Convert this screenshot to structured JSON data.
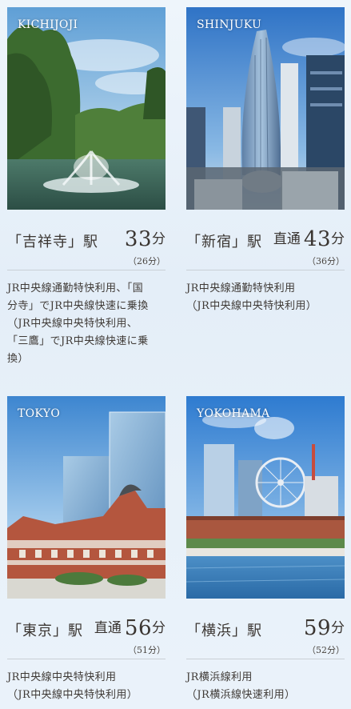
{
  "cards": [
    {
      "photo_label": "KICHIJOJI",
      "station": "「吉祥寺」駅",
      "direct": "",
      "minutes": "33",
      "unit": "分",
      "sub": "（26分）",
      "desc": [
        "JR中央線通勤特快利用、「国",
        "分寺」でJR中央線快速に乗換",
        "（JR中央線中央特快利用、",
        "「三鷹」でJR中央線快速に乗",
        "換）"
      ]
    },
    {
      "photo_label": "SHINJUKU",
      "station": "「新宿」駅",
      "direct": "直通",
      "minutes": "43",
      "unit": "分",
      "sub": "（36分）",
      "desc": [
        "JR中央線通勤特快利用",
        "（JR中央線中央特快利用）"
      ]
    },
    {
      "photo_label": "TOKYO",
      "station": "「東京」駅",
      "direct": "直通",
      "minutes": "56",
      "unit": "分",
      "sub": "（51分）",
      "desc": [
        "JR中央線中央特快利用",
        "（JR中央線中央特快利用）"
      ]
    },
    {
      "photo_label": "YOKOHAMA",
      "station": "「横浜」駅",
      "direct": "",
      "minutes": "59",
      "unit": "分",
      "sub": "（52分）",
      "desc": [
        "JR横浜線利用",
        "（JR横浜線快速利用）"
      ]
    }
  ]
}
